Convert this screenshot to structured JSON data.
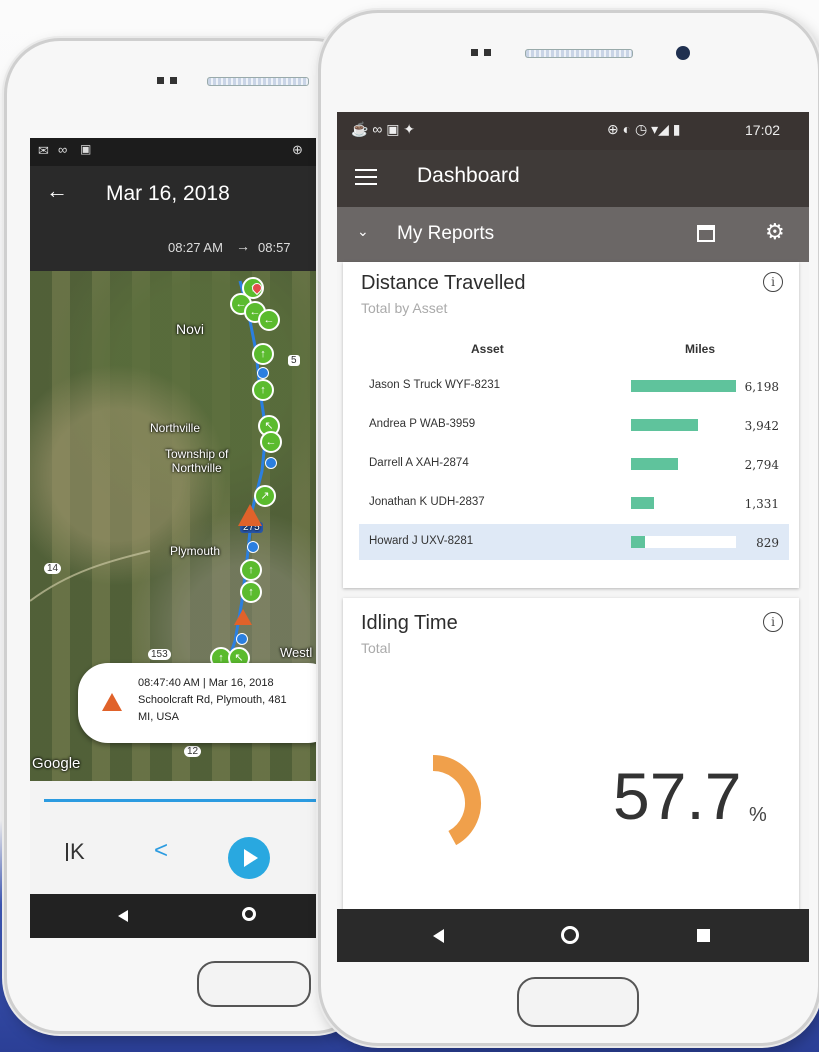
{
  "left_phone": {
    "status_icons": [
      "mail-icon",
      "voicemail-icon",
      "image-icon"
    ],
    "header": {
      "date": "Mar 16, 2018",
      "start_time": "08:27 AM",
      "end_time": "08:57"
    },
    "map": {
      "labels": {
        "novi": "Novi",
        "northville": "Northville",
        "township": "Township of\nNorthville",
        "plymouth": "Plymouth",
        "westland": "Westl",
        "route_5": "5",
        "route_275": "275",
        "route_14": "14",
        "route_153": "153",
        "route_12": "12"
      },
      "attribution": "Google"
    },
    "popup": {
      "line1": "08:47:40 AM | Mar 16, 2018",
      "line2": "Schoolcraft Rd, Plymouth, 481",
      "line3": "MI, USA"
    },
    "playback": {
      "first_label": "K",
      "prev_label": "<"
    }
  },
  "right_phone": {
    "status": {
      "time": "17:02"
    },
    "appbar": {
      "title": "Dashboard"
    },
    "subbar": {
      "title": "My Reports"
    },
    "distance_card": {
      "title": "Distance Travelled",
      "subtitle": "Total by Asset",
      "col_asset": "Asset",
      "col_miles": "Miles",
      "rows": [
        {
          "asset": "Jason S Truck WYF-8231",
          "miles": "6,198",
          "value": 6198
        },
        {
          "asset": "Andrea P WAB-3959",
          "miles": "3,942",
          "value": 3942
        },
        {
          "asset": "Darrell A XAH-2874",
          "miles": "2,794",
          "value": 2794
        },
        {
          "asset": "Jonathan K UDH-2837",
          "miles": "1,331",
          "value": 1331
        },
        {
          "asset": "Howard J UXV-8281",
          "miles": "829",
          "value": 829
        }
      ]
    },
    "idling_card": {
      "title": "Idling Time",
      "subtitle": "Total",
      "value": "57.7",
      "unit": "%",
      "fraction": 0.42
    }
  },
  "colors": {
    "bar": "#5fc39c",
    "donut": "#f0a04b",
    "pin": "#5bbb2e",
    "warning": "#e0622a",
    "play": "#29a8e0"
  }
}
